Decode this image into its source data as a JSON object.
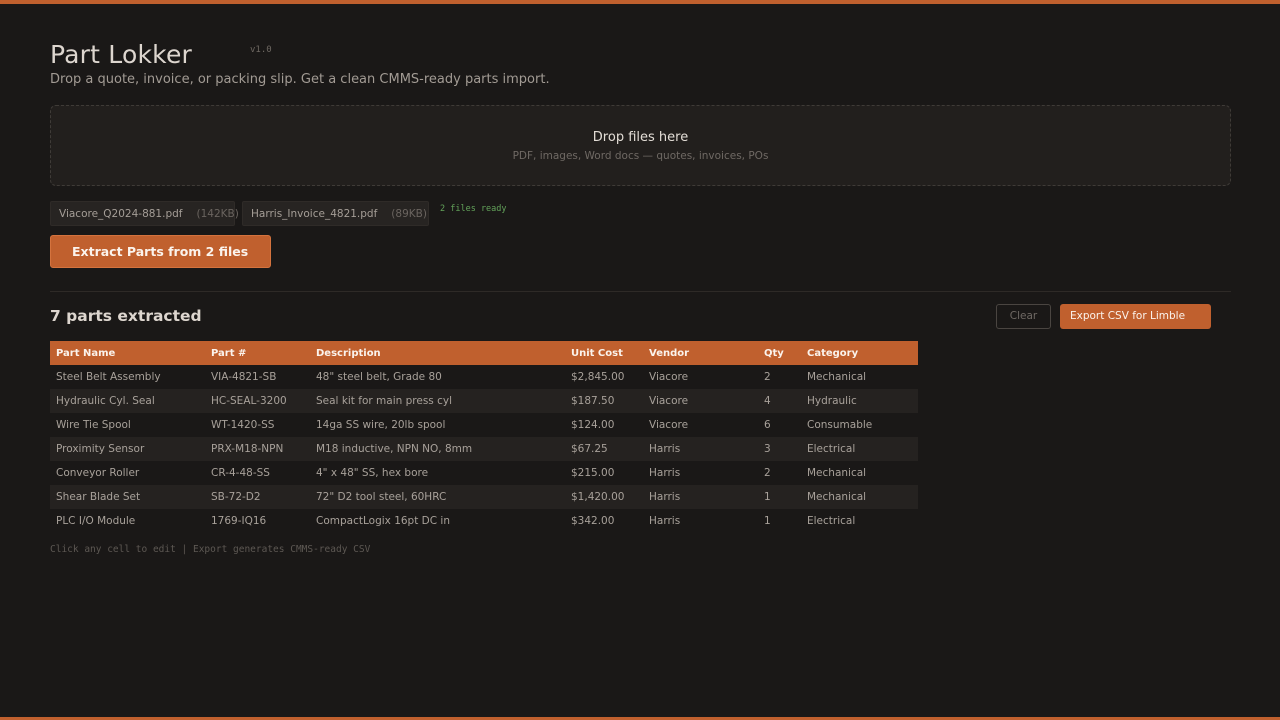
{
  "app": {
    "title": "Part Lokker",
    "version": "v1.0",
    "subtitle": "Drop a quote, invoice, or packing slip. Get a clean CMMS-ready parts import."
  },
  "dropzone": {
    "title": "Drop files here",
    "subtitle": "PDF, images, Word docs  —  quotes, invoices, POs"
  },
  "files": [
    {
      "name": "Viacore_Q2024-881.pdf",
      "size": "(142KB)"
    },
    {
      "name": "Harris_Invoice_4821.pdf",
      "size": "(89KB)"
    }
  ],
  "files_status": "2 files ready",
  "extract_button": "Extract Parts from 2 files",
  "results": {
    "count_title": "7 parts extracted",
    "clear_label": "Clear",
    "export_label": "Export CSV for Limble"
  },
  "table": {
    "columns": [
      "Part Name",
      "Part #",
      "Description",
      "Unit Cost",
      "Vendor",
      "Qty",
      "Category"
    ],
    "rows": [
      [
        "Steel Belt Assembly",
        "VIA-4821-SB",
        "48\" steel belt, Grade 80",
        "$2,845.00",
        "Viacore",
        "2",
        "Mechanical"
      ],
      [
        "Hydraulic Cyl. Seal",
        "HC-SEAL-3200",
        "Seal kit for main press cyl",
        "$187.50",
        "Viacore",
        "4",
        "Hydraulic"
      ],
      [
        "Wire Tie Spool",
        "WT-1420-SS",
        "14ga SS wire, 20lb spool",
        "$124.00",
        "Viacore",
        "6",
        "Consumable"
      ],
      [
        "Proximity Sensor",
        "PRX-M18-NPN",
        "M18 inductive, NPN NO, 8mm",
        "$67.25",
        "Harris",
        "3",
        "Electrical"
      ],
      [
        "Conveyor Roller",
        "CR-4-48-SS",
        "4\" x 48\" SS, hex bore",
        "$215.00",
        "Harris",
        "2",
        "Mechanical"
      ],
      [
        "Shear Blade Set",
        "SB-72-D2",
        "72\" D2 tool steel, 60HRC",
        "$1,420.00",
        "Harris",
        "1",
        "Mechanical"
      ],
      [
        "PLC I/O Module",
        "1769-IQ16",
        "CompactLogix 16pt DC in",
        "$342.00",
        "Harris",
        "1",
        "Electrical"
      ]
    ]
  },
  "footer_note": "Click any cell to edit  |  Export generates CMMS-ready CSV",
  "colors": {
    "accent": "#c0602e",
    "background": "#1a1817",
    "ready_green": "#63a35a"
  }
}
